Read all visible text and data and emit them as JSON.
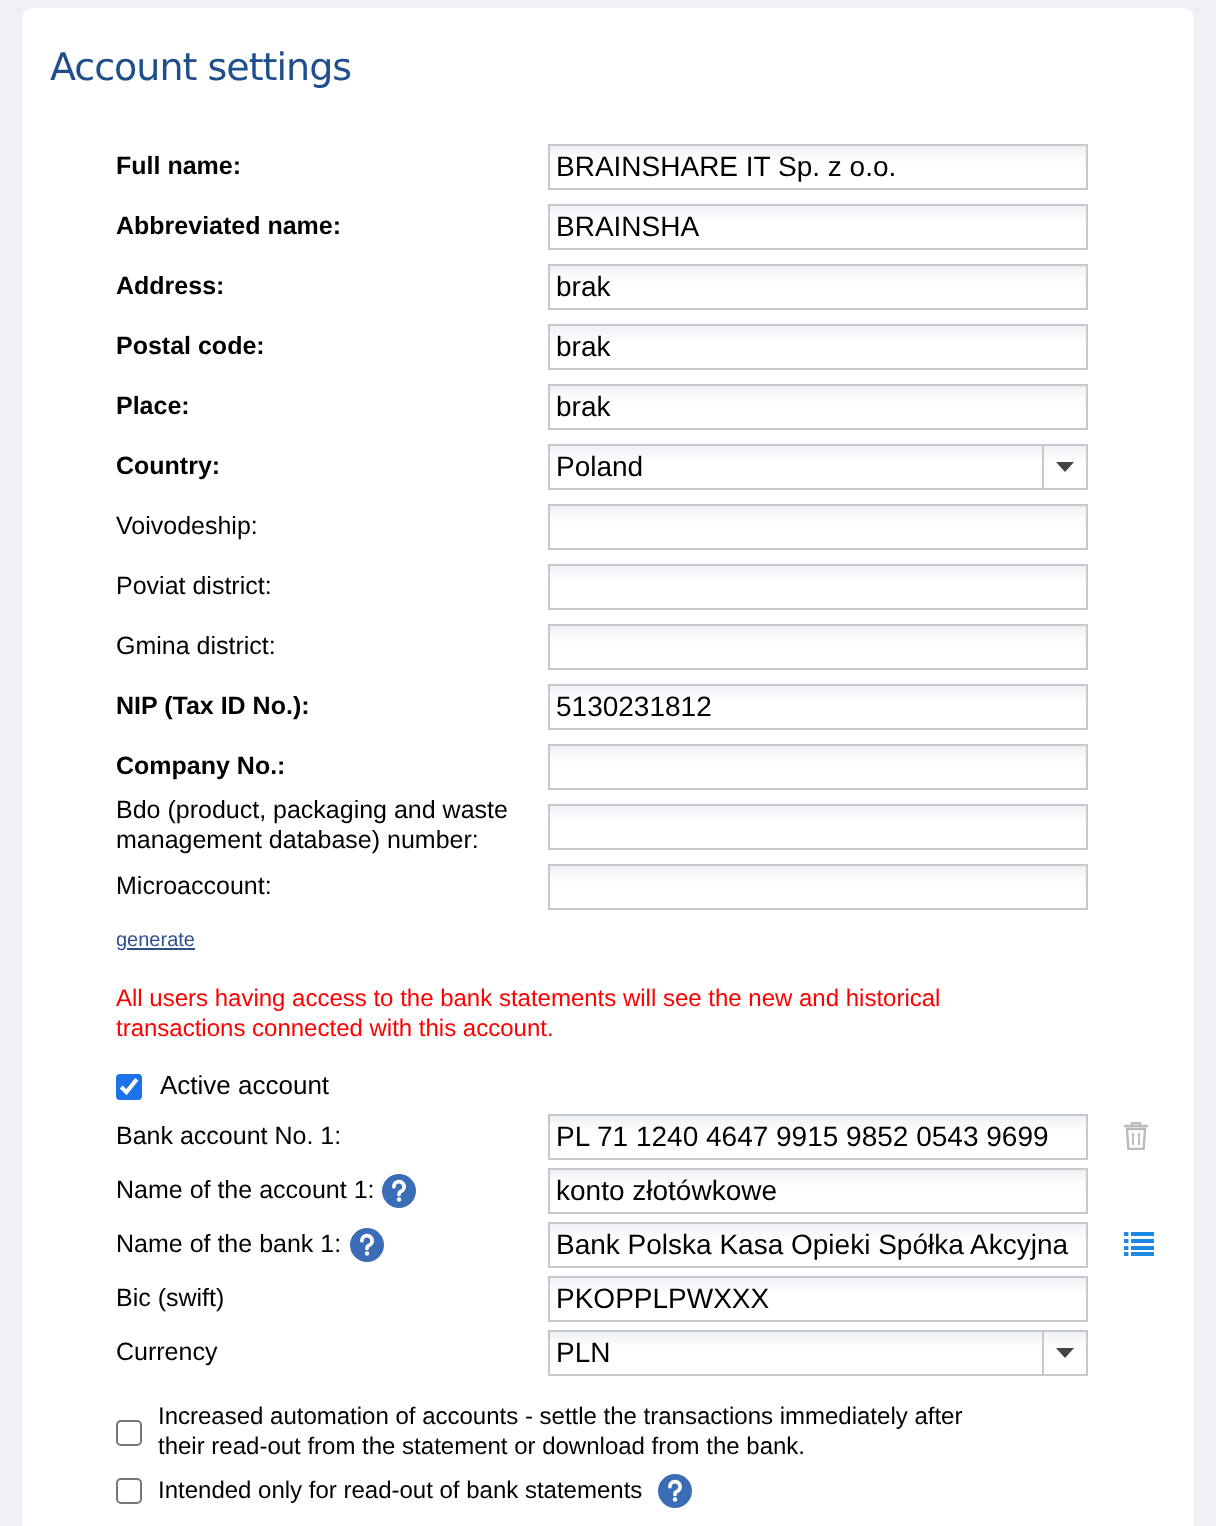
{
  "title": "Account settings",
  "fields": [
    {
      "label": "Full name:",
      "bold": true,
      "kind": "text",
      "value": "BRAINSHARE IT Sp. z o.o."
    },
    {
      "label": "Abbreviated name:",
      "bold": true,
      "kind": "text",
      "value": "BRAINSHA"
    },
    {
      "label": "Address:",
      "bold": true,
      "kind": "text",
      "value": "brak"
    },
    {
      "label": "Postal code:",
      "bold": true,
      "kind": "text",
      "value": "brak"
    },
    {
      "label": "Place:",
      "bold": true,
      "kind": "text",
      "value": "brak"
    },
    {
      "label": "Country:",
      "bold": true,
      "kind": "select",
      "value": "Poland"
    },
    {
      "label": "Voivodeship:",
      "bold": false,
      "kind": "text"
    },
    {
      "label": "Poviat district:",
      "bold": false,
      "kind": "text"
    },
    {
      "label": "Gmina district:",
      "bold": false,
      "kind": "text"
    },
    {
      "label": "NIP (Tax ID No.):",
      "bold": true,
      "kind": "text",
      "value": "5130231812"
    },
    {
      "label": "Company No.:",
      "bold": true,
      "kind": "text"
    },
    {
      "label": "Bdo (product, packaging and waste management database) number:",
      "bold": false,
      "kind": "text"
    },
    {
      "label": "Microaccount:",
      "bold": false,
      "kind": "text"
    }
  ],
  "generate_link": "generate",
  "warning": "All users having access to the bank statements will see the new and historical transactions connected with this account.",
  "active_account": {
    "label": "Active account",
    "checked": true
  },
  "bank_fields": [
    {
      "label": "Bank account No. 1:",
      "kind": "text",
      "value": "PL 71 1240 4647 9915 9852 0543 9699",
      "help": false,
      "action": {
        "kind": "delete"
      }
    },
    {
      "label": "Name of the account 1:",
      "kind": "text",
      "value": "konto złotówkowe",
      "help": true
    },
    {
      "label": "Name of the bank 1:",
      "kind": "text",
      "value": "Bank Polska Kasa Opieki Spółka Akcyjna",
      "help": true,
      "action": {
        "kind": "list"
      }
    },
    {
      "label": "Bic (swift)",
      "kind": "text",
      "value": "PKOPPLPWXXX",
      "help": false
    },
    {
      "label": "Currency",
      "kind": "select",
      "value": "PLN",
      "help": false
    }
  ],
  "options": [
    {
      "label": "Increased automation of accounts - settle the transactions immediately after their read-out from the statement or download from the bank.",
      "checked": false,
      "help": false
    },
    {
      "label": "Intended only for read-out of bank statements",
      "checked": false,
      "help": true
    }
  ]
}
